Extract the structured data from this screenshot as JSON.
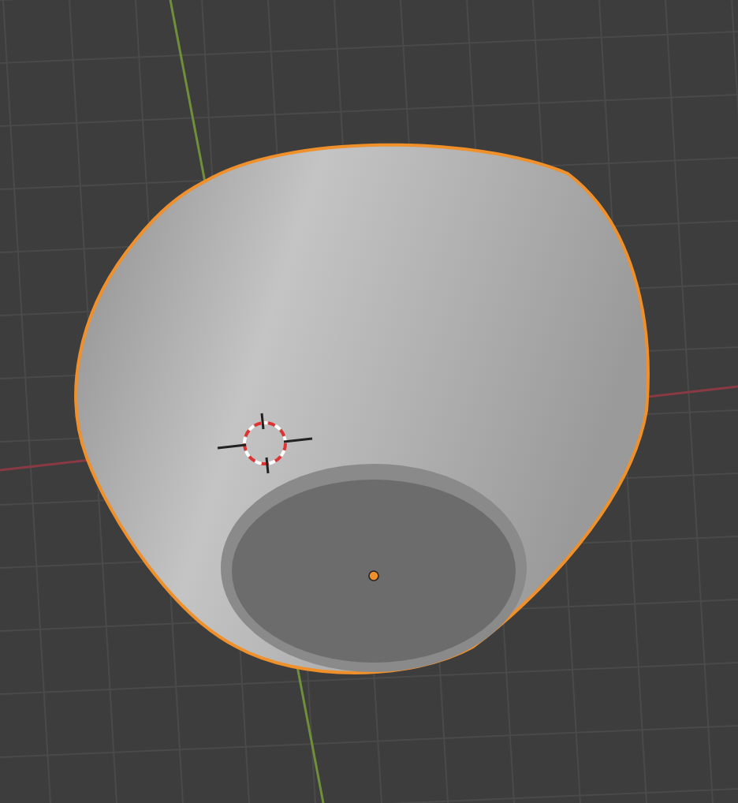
{
  "viewport": {
    "object_selected": true
  }
}
